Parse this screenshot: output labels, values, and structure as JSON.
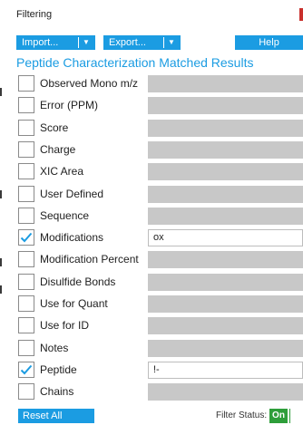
{
  "window": {
    "title": "Filtering"
  },
  "toolbar": {
    "import_label": "Import...",
    "export_label": "Export...",
    "help_label": "Help"
  },
  "section": {
    "heading": "Peptide Characterization Matched Results"
  },
  "filters": [
    {
      "label": "Observed Mono m/z",
      "checked": false,
      "value": ""
    },
    {
      "label": "Error (PPM)",
      "checked": false,
      "value": ""
    },
    {
      "label": "Score",
      "checked": false,
      "value": ""
    },
    {
      "label": "Charge",
      "checked": false,
      "value": ""
    },
    {
      "label": "XIC Area",
      "checked": false,
      "value": ""
    },
    {
      "label": "User Defined",
      "checked": false,
      "value": ""
    },
    {
      "label": "Sequence",
      "checked": false,
      "value": ""
    },
    {
      "label": "Modifications",
      "checked": true,
      "value": "ox"
    },
    {
      "label": "Modification Percent",
      "checked": false,
      "value": ""
    },
    {
      "label": "Disulfide Bonds",
      "checked": false,
      "value": ""
    },
    {
      "label": "Use for Quant",
      "checked": false,
      "value": ""
    },
    {
      "label": "Use for ID",
      "checked": false,
      "value": ""
    },
    {
      "label": "Notes",
      "checked": false,
      "value": ""
    },
    {
      "label": "Peptide",
      "checked": true,
      "value": "!-"
    },
    {
      "label": "Chains",
      "checked": false,
      "value": ""
    }
  ],
  "footer": {
    "reset_label": "Reset All",
    "filter_status_label": "Filter Status:",
    "filter_status_value": "On"
  },
  "colors": {
    "accent": "#1b9ce2",
    "status_on": "#2e9e3a",
    "disabled_field": "#c8c8c8",
    "close": "#c9302c"
  }
}
